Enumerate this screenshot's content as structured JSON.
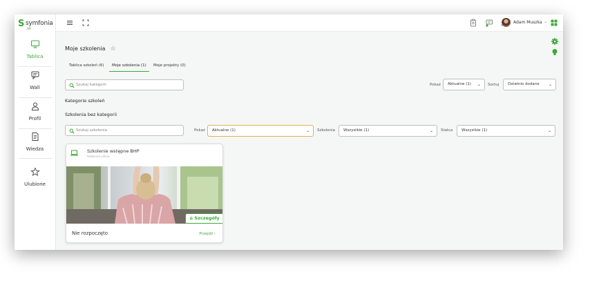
{
  "app": {
    "logo_mark": "S",
    "logo_name": "symfonia",
    "logo_sub": "HR",
    "brand_color": "#3aaa35"
  },
  "sidebar": {
    "items": [
      {
        "label": "Tablica",
        "icon": "monitor-icon",
        "active": true
      },
      {
        "label": "Wall",
        "icon": "chat-icon",
        "active": false
      },
      {
        "label": "Profil",
        "icon": "person-icon",
        "active": false
      },
      {
        "label": "Wiedza",
        "icon": "document-icon",
        "active": false
      },
      {
        "label": "Ulubione",
        "icon": "star-icon",
        "active": false
      }
    ]
  },
  "topbar": {
    "user_name": "Adam Muszka"
  },
  "page": {
    "title": "Moje szkolenia",
    "tabs": [
      {
        "label": "Tablica szkoleń (6)"
      },
      {
        "label": "Moje szkolenia (1)"
      },
      {
        "label": "Moje projekty (0)"
      }
    ],
    "category_search_placeholder": "Szukaj kategorii",
    "show_label": "Pokaż",
    "show_value": "Aktualne (1)",
    "sort_label": "Sortuj",
    "sort_value": "Ostatnio dodane",
    "categories_heading": "Kategorie szkoleń",
    "no_category_heading": "Szkolenia bez kategorii"
  },
  "filters": {
    "search_placeholder": "Szukaj szkolenia",
    "show_label": "Pokaż",
    "show_value": "Aktualne (1)",
    "trainings_label": "Szkolenia",
    "trainings_value": "Wszystkie (1)",
    "status_label": "Status",
    "status_value": "Wszystkie (1)"
  },
  "card": {
    "title": "Szkolenie wstępne BHP",
    "subtitle": "Szkolenie online",
    "details_label": "Szczegóły",
    "status": "Nie rozpoczęto",
    "link_label": "Przejdź"
  }
}
